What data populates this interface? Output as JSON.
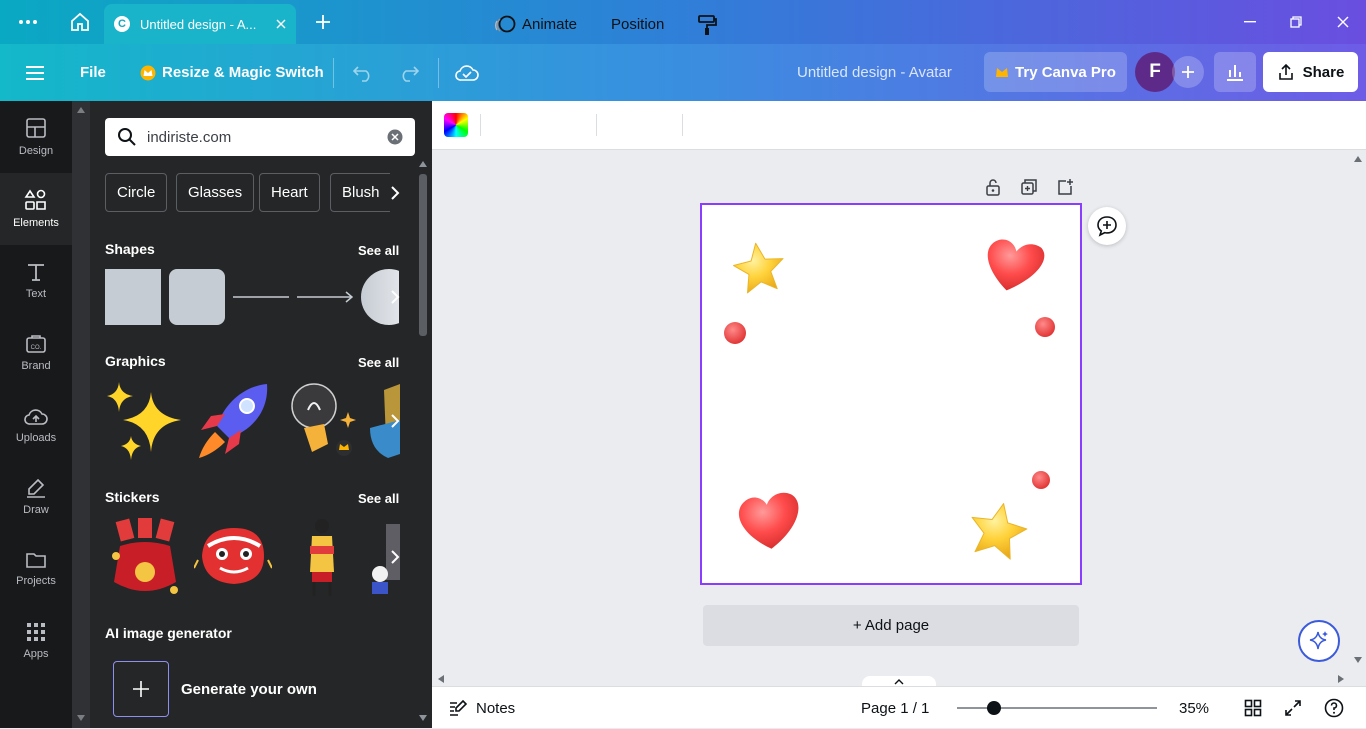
{
  "browser": {
    "tab_title": "Untitled design - A...",
    "tab_favicon": "C"
  },
  "header": {
    "file_label": "File",
    "resize_label": "Resize & Magic Switch",
    "design_title": "Untitled design - Avatar",
    "try_pro_label": "Try Canva Pro",
    "avatar_initial": "F",
    "share_label": "Share"
  },
  "rail": {
    "items": [
      {
        "label": "Design"
      },
      {
        "label": "Elements"
      },
      {
        "label": "Text"
      },
      {
        "label": "Brand"
      },
      {
        "label": "Uploads"
      },
      {
        "label": "Draw"
      },
      {
        "label": "Projects"
      },
      {
        "label": "Apps"
      }
    ]
  },
  "panel": {
    "search_value": "indiriste.com",
    "chips": [
      "Circle",
      "Glasses",
      "Heart",
      "Blush"
    ],
    "sections": {
      "shapes": "Shapes",
      "graphics": "Graphics",
      "stickers": "Stickers",
      "ai": "AI image generator"
    },
    "see_all": "See all",
    "generate_label": "Generate your own"
  },
  "toolbar": {
    "animate_label": "Animate",
    "position_label": "Position"
  },
  "canvas": {
    "add_page_label": "+ Add page"
  },
  "footer": {
    "notes_label": "Notes",
    "page_label": "Page 1 / 1",
    "zoom_label": "35%",
    "zoom_value": 35
  },
  "colors": {
    "selection": "#8b3dff",
    "rail_bg": "#18191b",
    "panel_bg": "#252627",
    "heart": "#ff4a4a",
    "star": "#ffcc33",
    "pro_crown": "#ffb400"
  }
}
